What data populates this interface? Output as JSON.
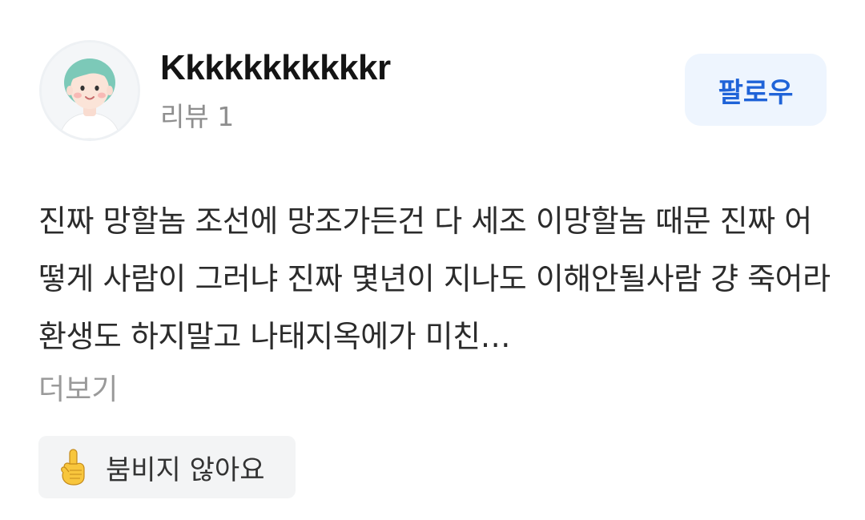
{
  "profile": {
    "username": "Kkkkkkkkkkkr",
    "review_count": "리뷰 1",
    "avatar_icon": "cartoon-person-avatar",
    "follow_label": "팔로우"
  },
  "review": {
    "body": "진짜 망할놈 조선에 망조가든건 다 세조 이망할놈 때문 진짜 어떻게 사람이 그러냐 진짜 몇년이 지나도 이해안될사람 걍 죽어라 환생도 하지말고 나태지옥에가 미친…",
    "more_label": "더보기"
  },
  "reaction": {
    "icon": "pointing-up-hand-icon",
    "label": "붐비지 않아요"
  },
  "colors": {
    "accent": "#1f63d8",
    "follow_bg": "#eef5fe",
    "chip_bg": "#f3f4f5",
    "muted_text": "#9a9a9a"
  }
}
